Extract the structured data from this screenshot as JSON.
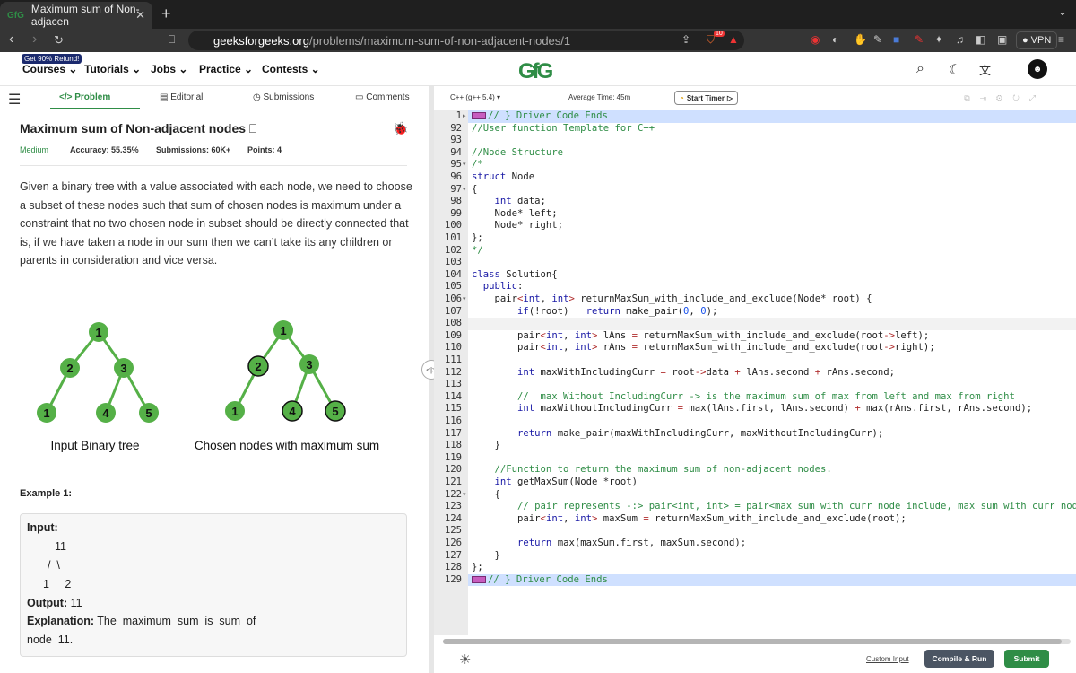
{
  "browser": {
    "tab_title": "Maximum sum of Non-adjacen",
    "tab_favicon": "GfG",
    "url_host": "geeksforgeeks.org",
    "url_path": "/problems/maximum-sum-of-non-adjacent-nodes/1",
    "vpn_label": "VPN",
    "brave_badge": "10"
  },
  "site_nav": {
    "promo": "Get 90% Refund!",
    "items": [
      "Courses",
      "Tutorials",
      "Jobs",
      "Practice",
      "Contests"
    ],
    "logo": "GfG"
  },
  "problem_tabs": [
    "Problem",
    "Editorial",
    "Submissions",
    "Comments"
  ],
  "problem": {
    "title": "Maximum sum of Non-adjacent nodes",
    "difficulty": "Medium",
    "accuracy_label": "Accuracy:",
    "accuracy": "55.35%",
    "submissions_label": "Submissions:",
    "submissions": "60K+",
    "points_label": "Points:",
    "points": "4",
    "description": "Given a binary tree with a value associated with each node, we need to choose a subset of these nodes such that sum of chosen nodes is maximum under a constraint that no two chosen node in subset should be directly connected that is, if we have taken a node in our sum then we can’t take its any children or parents in consideration and vice versa.",
    "tree_left_caption": "Input Binary tree",
    "tree_right_caption": "Chosen nodes with maximum sum",
    "tree_nodes": [
      "1",
      "2",
      "3",
      "1",
      "4",
      "5"
    ],
    "example_title": "Example 1:",
    "example": {
      "input_label": "Input:",
      "l1": "11",
      "l2": "/  \\",
      "l3": "1     2",
      "output_label": "Output:",
      "output": "11",
      "explanation_label": "Explanation:",
      "explanation_a": "The  maximum  sum  is  sum  of",
      "explanation_b": "node  11."
    }
  },
  "editor": {
    "language": "C++ (g++ 5.4)",
    "average_time": "Average Time: 45m",
    "timer_label": "Start Timer",
    "custom_input": "Custom Input",
    "compile_run": "Compile & Run",
    "submit": "Submit",
    "line_numbers": [
      "1",
      "92",
      "93",
      "94",
      "95",
      "96",
      "97",
      "98",
      "99",
      "100",
      "101",
      "102",
      "103",
      "104",
      "105",
      "106",
      "107",
      "108",
      "109",
      "110",
      "111",
      "112",
      "113",
      "114",
      "115",
      "116",
      "117",
      "118",
      "119",
      "120",
      "121",
      "122",
      "123",
      "124",
      "125",
      "126",
      "127",
      "128",
      "129"
    ],
    "code_lines": [
      "// } Driver Code Ends",
      "//User function Template for C++",
      "",
      "//Node Structure",
      "/*",
      "struct Node",
      "{",
      "    int data;",
      "    Node* left;",
      "    Node* right;",
      "};",
      "*/",
      "",
      "class Solution{",
      "  public:",
      "    pair<int, int> returnMaxSum_with_include_and_exclude(Node* root) {",
      "        if(!root)   return make_pair(0, 0);",
      "",
      "        pair<int, int> lAns = returnMaxSum_with_include_and_exclude(root->left);",
      "        pair<int, int> rAns = returnMaxSum_with_include_and_exclude(root->right);",
      "",
      "        int maxWithIncludingCurr = root->data + lAns.second + rAns.second;",
      "",
      "        //  max Without IncludingCurr -> is the maximum sum of max from left and max from right",
      "        int maxWithoutIncludingCurr = max(lAns.first, lAns.second) + max(rAns.first, rAns.second);",
      "",
      "        return make_pair(maxWithIncludingCurr, maxWithoutIncludingCurr);",
      "    }",
      "",
      "    //Function to return the maximum sum of non-adjacent nodes.",
      "    int getMaxSum(Node *root)",
      "    {",
      "        // pair represents -:> pair<int, int> = pair<max sum with curr_node include, max sum with curr_node exclu",
      "        pair<int, int> maxSum = returnMaxSum_with_include_and_exclude(root);",
      "",
      "        return max(maxSum.first, maxSum.second);",
      "    }",
      "};",
      "// } Driver Code Ends"
    ]
  }
}
